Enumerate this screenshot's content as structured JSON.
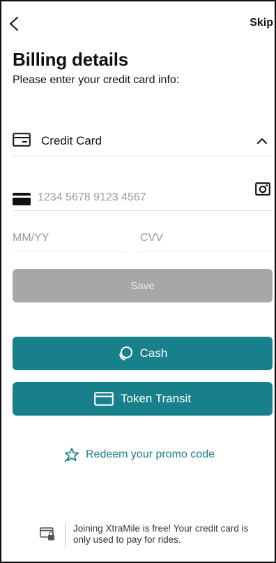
{
  "header": {
    "skip_label": "Skip"
  },
  "page": {
    "title": "Billing details",
    "subtitle": "Please enter your credit card info:"
  },
  "payment_method": {
    "label": "Credit Card",
    "expanded": true
  },
  "card_form": {
    "card_number_placeholder": "1234 5678 9123 4567",
    "expiry_placeholder": "MM/YY",
    "cvv_placeholder": "CVV",
    "save_label": "Save"
  },
  "alternatives": {
    "cash_label": "Cash",
    "token_transit_label": "Token Transit"
  },
  "promo": {
    "label": "Redeem your promo code"
  },
  "footer": {
    "text": "Joining XtraMile is free! Your credit card is only used to pay for rides."
  },
  "colors": {
    "accent": "#17808a",
    "disabled": "#a7a7a7"
  }
}
